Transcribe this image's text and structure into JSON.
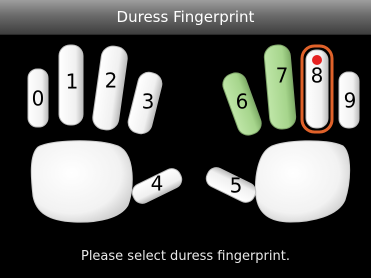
{
  "title": "Duress Fingerprint",
  "footer_message": "Please select duress fingerprint.",
  "colors": {
    "finger_default": "#f2f2f2",
    "finger_registered": "#a8d68e",
    "finger_selected": "#f2f2f2",
    "selected_border": "#e0622a",
    "selected_dot": "#e52222"
  },
  "fingers": [
    {
      "id": 0,
      "label": "0",
      "state": "default"
    },
    {
      "id": 1,
      "label": "1",
      "state": "default"
    },
    {
      "id": 2,
      "label": "2",
      "state": "default"
    },
    {
      "id": 3,
      "label": "3",
      "state": "default"
    },
    {
      "id": 4,
      "label": "4",
      "state": "default"
    },
    {
      "id": 5,
      "label": "5",
      "state": "default"
    },
    {
      "id": 6,
      "label": "6",
      "state": "registered"
    },
    {
      "id": 7,
      "label": "7",
      "state": "registered"
    },
    {
      "id": 8,
      "label": "8",
      "state": "selected"
    },
    {
      "id": 9,
      "label": "9",
      "state": "default"
    }
  ]
}
